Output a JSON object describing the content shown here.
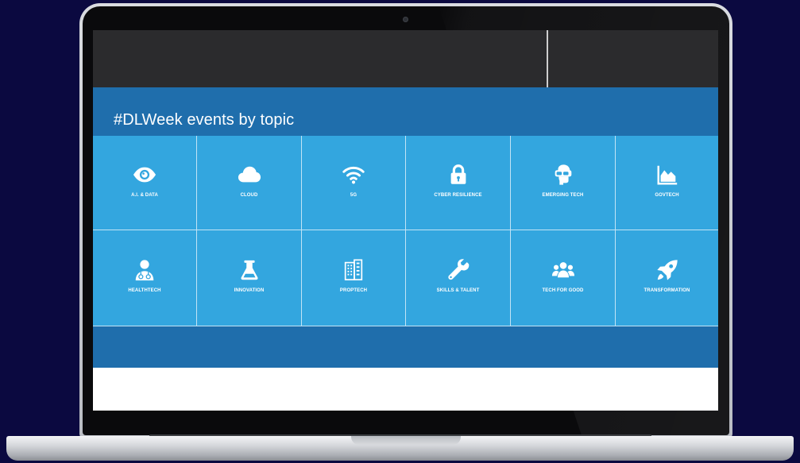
{
  "section": {
    "title": "#DLWeek events by topic"
  },
  "topics": [
    {
      "label": "A.I. & DATA",
      "icon": "eye-icon"
    },
    {
      "label": "CLOUD",
      "icon": "cloud-icon"
    },
    {
      "label": "5G",
      "icon": "wifi-icon"
    },
    {
      "label": "CYBER RESILIENCE",
      "icon": "lock-icon"
    },
    {
      "label": "EMERGING TECH",
      "icon": "vr-headset-icon"
    },
    {
      "label": "GOVTECH",
      "icon": "area-chart-icon"
    },
    {
      "label": "HEALTHTECH",
      "icon": "doctor-icon"
    },
    {
      "label": "INNOVATION",
      "icon": "flask-icon"
    },
    {
      "label": "PROPTECH",
      "icon": "building-icon"
    },
    {
      "label": "SKILLS & TALENT",
      "icon": "wrench-icon"
    },
    {
      "label": "TECH FOR GOOD",
      "icon": "users-icon"
    },
    {
      "label": "TRANSFORMATION",
      "icon": "rocket-icon"
    }
  ],
  "colors": {
    "page_background": "#0b0940",
    "header_bar": "#2b2b2d",
    "section_background": "#1f6eac",
    "tile_background": "#33a6df",
    "text": "#ffffff"
  }
}
